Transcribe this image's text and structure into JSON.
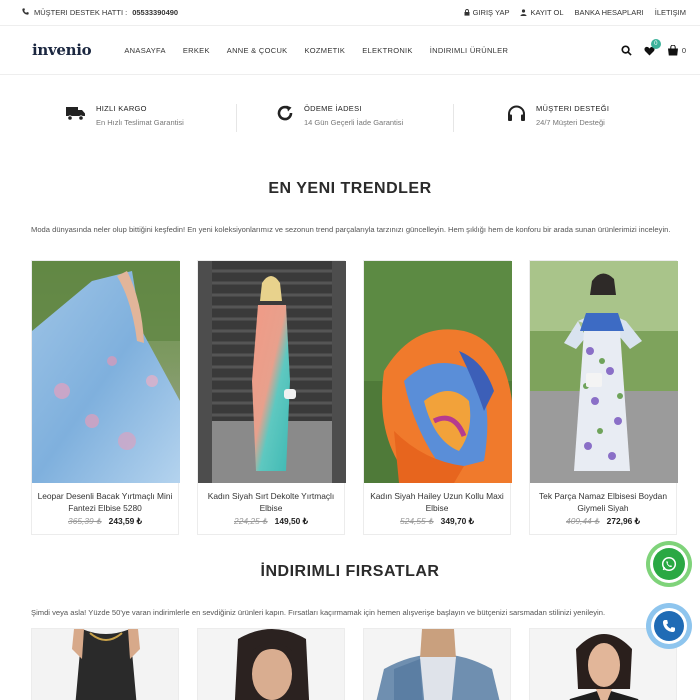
{
  "topbar": {
    "support_label": "MÜŞTERI DESTEK HATTI :",
    "support_phone": "05533390490",
    "login": "GIRIŞ YAP",
    "register": "KAYIT OL",
    "bank": "BANKA HESAPLARI",
    "contact": "İLETIŞIM"
  },
  "header": {
    "logo": "invenio",
    "nav": [
      "ANASAYFA",
      "ERKEK",
      "ANNE & ÇOCUK",
      "KOZMETIK",
      "ELEKTRONIK",
      "İNDIRIMLI ÜRÜNLER"
    ],
    "wishlist_count": "0",
    "cart_count": "0"
  },
  "features": [
    {
      "title": "HIZLI KARGO",
      "subtitle": "En Hızlı Teslimat Garantisi",
      "icon": "truck-icon"
    },
    {
      "title": "ÖDEME İADESI",
      "subtitle": "14 Gün Geçerli İade Garantisi",
      "icon": "refresh-icon"
    },
    {
      "title": "MÜŞTERI DESTEĞI",
      "subtitle": "24/7 Müşteri Desteği",
      "icon": "headphones-icon"
    }
  ],
  "trends": {
    "title": "EN YENI TRENDLER",
    "description": "Moda dünyasında neler olup bittiğini keşfedin! En yeni koleksiyonlarımız ve sezonun trend parçalarıyla tarzınızı güncelleyin. Hem şıklığı hem de konforu bir arada sunan ürünlerimizi inceleyin.",
    "products": [
      {
        "name": "Leopar Desenli Bacak Yırtmaçlı Mini Fantezi Elbise 5280",
        "old_price": "365,39 ₺",
        "price": "243,59 ₺"
      },
      {
        "name": "Kadın Siyah Sırt Dekolte Yırtmaçlı Elbise",
        "old_price": "224,25 ₺",
        "price": "149,50 ₺"
      },
      {
        "name": "Kadın Siyah Hailey Uzun Kollu Maxi Elbise",
        "old_price": "524,55 ₺",
        "price": "349,70 ₺"
      },
      {
        "name": "Tek Parça Namaz Elbisesi Boydan Giymeli Siyah",
        "old_price": "409,44 ₺",
        "price": "272,96 ₺"
      }
    ]
  },
  "deals": {
    "title": "İNDIRIMLI FIRSATLAR",
    "description": "Şimdi veya asla! Yüzde 50'ye varan indirimlerle en sevdiğiniz ürünleri kapın. Fırsatları kaçırmamak için hemen alışverişe başlayın ve bütçenizi sarsmadan stilinizi yenileyin."
  },
  "colors": {
    "accent": "#3cb29a",
    "whatsapp": "#2aa843",
    "call": "#1f6bb5"
  }
}
